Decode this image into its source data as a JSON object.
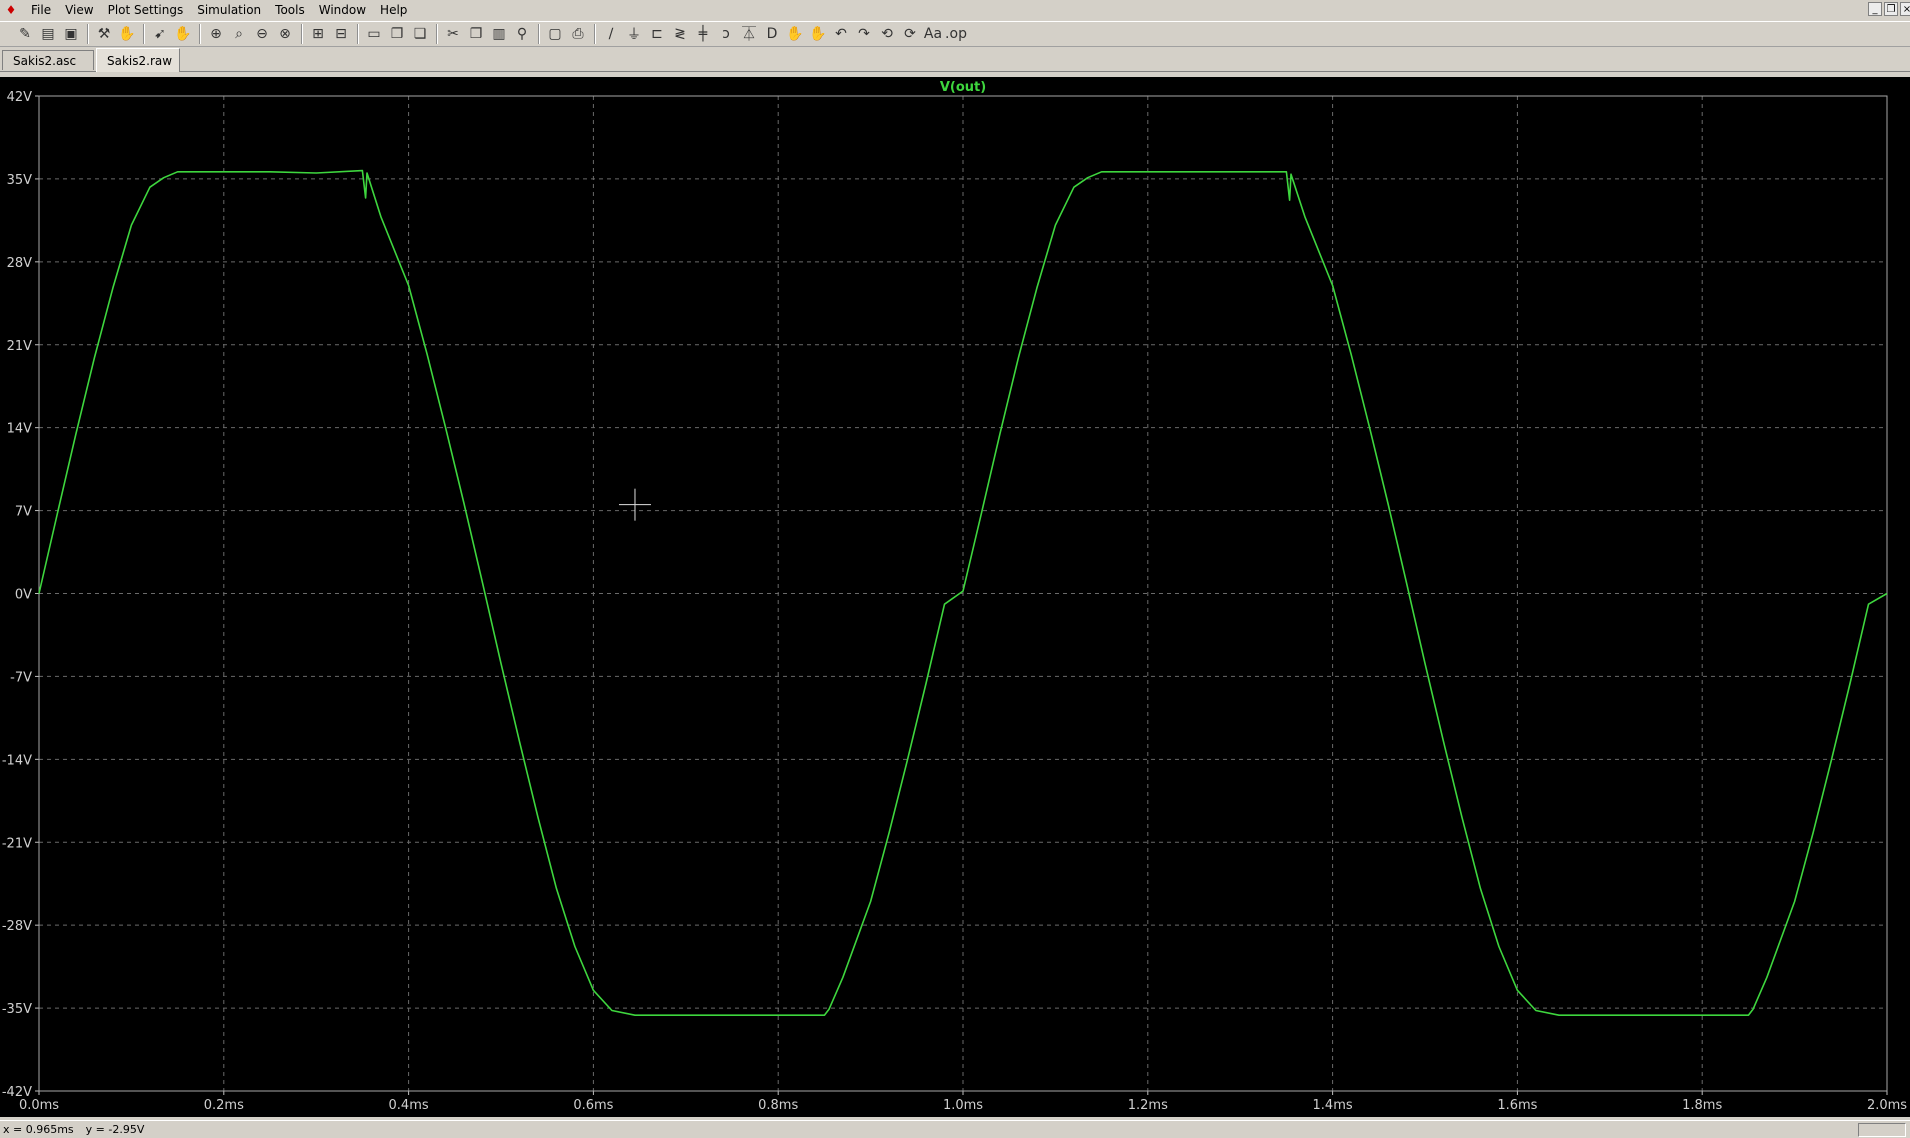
{
  "menu": {
    "items": [
      "File",
      "View",
      "Plot Settings",
      "Simulation",
      "Tools",
      "Window",
      "Help"
    ]
  },
  "window_controls": [
    "minimize-icon",
    "restore-icon",
    "close-icon"
  ],
  "toolbar": {
    "groups": [
      [
        {
          "name": "new-schematic-icon",
          "glyph": "✎"
        },
        {
          "name": "open-file-icon",
          "glyph": "▤"
        },
        {
          "name": "save-icon",
          "glyph": "▣"
        }
      ],
      [
        {
          "name": "control-panel-icon",
          "glyph": "⚒"
        },
        {
          "name": "pan-hand-icon",
          "glyph": "✋"
        }
      ],
      [
        {
          "name": "run-icon",
          "glyph": "➹"
        },
        {
          "name": "halt-hand-icon",
          "glyph": "✋"
        }
      ],
      [
        {
          "name": "zoom-in-icon",
          "glyph": "⊕"
        },
        {
          "name": "zoom-area-icon",
          "glyph": "⌕"
        },
        {
          "name": "zoom-out-icon",
          "glyph": "⊖"
        },
        {
          "name": "zoom-cancel-icon",
          "glyph": "⊗"
        }
      ],
      [
        {
          "name": "autorange-icon",
          "glyph": "⊞"
        },
        {
          "name": "mark-unused-icon",
          "glyph": "⊟"
        }
      ],
      [
        {
          "name": "tile-horizontal-icon",
          "glyph": "▭"
        },
        {
          "name": "cascade-icon",
          "glyph": "❐"
        },
        {
          "name": "tile-vertical-icon",
          "glyph": "❏"
        }
      ],
      [
        {
          "name": "cut-icon",
          "glyph": "✂"
        },
        {
          "name": "copy-icon",
          "glyph": "❐"
        },
        {
          "name": "paste-icon",
          "glyph": "▥"
        },
        {
          "name": "find-icon",
          "glyph": "⚲"
        }
      ],
      [
        {
          "name": "print-preview-icon",
          "glyph": "▢"
        },
        {
          "name": "print-icon",
          "glyph": "⎙"
        }
      ],
      [
        {
          "name": "draw-wire-icon",
          "glyph": "∕"
        },
        {
          "name": "ground-icon",
          "glyph": "⏚"
        },
        {
          "name": "label-net-icon",
          "glyph": "⊏"
        },
        {
          "name": "resistor-icon",
          "glyph": "≷"
        },
        {
          "name": "capacitor-icon",
          "glyph": "╪"
        },
        {
          "name": "inductor-icon",
          "glyph": "ↄ"
        },
        {
          "name": "diode-icon",
          "glyph": "⏄"
        },
        {
          "name": "component-icon",
          "glyph": "D"
        },
        {
          "name": "move-icon",
          "glyph": "✋"
        },
        {
          "name": "drag-icon",
          "glyph": "✋"
        },
        {
          "name": "undo-icon",
          "glyph": "↶"
        },
        {
          "name": "redo-icon",
          "glyph": "↷"
        },
        {
          "name": "rotate-icon",
          "glyph": "⟲"
        },
        {
          "name": "mirror-icon",
          "glyph": "⟳"
        },
        {
          "name": "text-icon",
          "glyph": "Aa"
        },
        {
          "name": "spice-directive-icon",
          "glyph": ".op"
        }
      ]
    ]
  },
  "tabs": [
    {
      "label": "Sakis2.asc",
      "active": false
    },
    {
      "label": "Sakis2.raw",
      "active": true
    }
  ],
  "chart_data": {
    "type": "line",
    "title": "V(out)",
    "xlabel": "",
    "ylabel": "",
    "xlim": [
      0.0,
      2.0
    ],
    "ylim": [
      -42,
      42
    ],
    "x_ticks": [
      0.0,
      0.2,
      0.4,
      0.6,
      0.8,
      1.0,
      1.2,
      1.4,
      1.6,
      1.8,
      2.0
    ],
    "x_tick_labels": [
      "0.0ms",
      "0.2ms",
      "0.4ms",
      "0.6ms",
      "0.8ms",
      "1.0ms",
      "1.2ms",
      "1.4ms",
      "1.6ms",
      "1.8ms",
      "2.0ms"
    ],
    "y_ticks": [
      42,
      35,
      28,
      21,
      14,
      7,
      0,
      -7,
      -14,
      -21,
      -28,
      -35,
      -42
    ],
    "y_tick_labels": [
      "42V",
      "35V",
      "28V",
      "21V",
      "14V",
      "7V",
      "0V",
      "-7V",
      "-14V",
      "-21V",
      "-28V",
      "-35V",
      "-42V"
    ],
    "grid": true,
    "background": "#000000",
    "series": [
      {
        "name": "V(out)",
        "color": "#3ed63e",
        "x": [
          0.0,
          0.02,
          0.04,
          0.06,
          0.08,
          0.1,
          0.12,
          0.135,
          0.15,
          0.2,
          0.25,
          0.3,
          0.35,
          0.3535,
          0.355,
          0.37,
          0.4,
          0.42,
          0.44,
          0.46,
          0.48,
          0.5,
          0.52,
          0.54,
          0.56,
          0.58,
          0.6,
          0.62,
          0.645,
          0.65,
          0.7,
          0.75,
          0.8,
          0.85,
          0.855,
          0.87,
          0.9,
          0.92,
          0.94,
          0.96,
          0.98,
          1.0,
          1.02,
          1.04,
          1.06,
          1.08,
          1.1,
          1.12,
          1.135,
          1.15,
          1.2,
          1.25,
          1.3,
          1.35,
          1.3535,
          1.355,
          1.37,
          1.4,
          1.42,
          1.44,
          1.46,
          1.48,
          1.5,
          1.52,
          1.54,
          1.56,
          1.58,
          1.6,
          1.62,
          1.645,
          1.65,
          1.7,
          1.75,
          1.8,
          1.85,
          1.855,
          1.87,
          1.9,
          1.92,
          1.94,
          1.96,
          1.98,
          2.0
        ],
        "y": [
          0.0,
          6.8,
          13.5,
          19.9,
          25.8,
          31.1,
          34.3,
          35.1,
          35.6,
          35.6,
          35.6,
          35.5,
          35.7,
          33.4,
          35.5,
          31.8,
          26.0,
          20.2,
          14.0,
          7.6,
          0.9,
          -5.9,
          -12.5,
          -18.9,
          -24.9,
          -29.8,
          -33.5,
          -35.2,
          -35.6,
          -35.6,
          -35.6,
          -35.6,
          -35.6,
          -35.6,
          -35.1,
          -32.4,
          -26.0,
          -20.2,
          -14.0,
          -7.6,
          -0.9,
          0.2,
          6.8,
          13.5,
          19.9,
          25.8,
          31.1,
          34.3,
          35.1,
          35.6,
          35.6,
          35.6,
          35.6,
          35.6,
          33.2,
          35.4,
          31.8,
          26.0,
          20.2,
          14.0,
          7.6,
          0.9,
          -5.9,
          -12.5,
          -18.9,
          -24.9,
          -29.8,
          -33.5,
          -35.2,
          -35.6,
          -35.6,
          -35.6,
          -35.6,
          -35.6,
          -35.6,
          -35.1,
          -32.4,
          -26.0,
          -20.2,
          -14.0,
          -7.6,
          -0.9,
          0.0
        ]
      }
    ],
    "cursor": {
      "x": 0.645,
      "y": 7.5
    }
  },
  "status": {
    "x_readout": "x = 0.965ms",
    "y_readout": "y = -2.95V"
  }
}
